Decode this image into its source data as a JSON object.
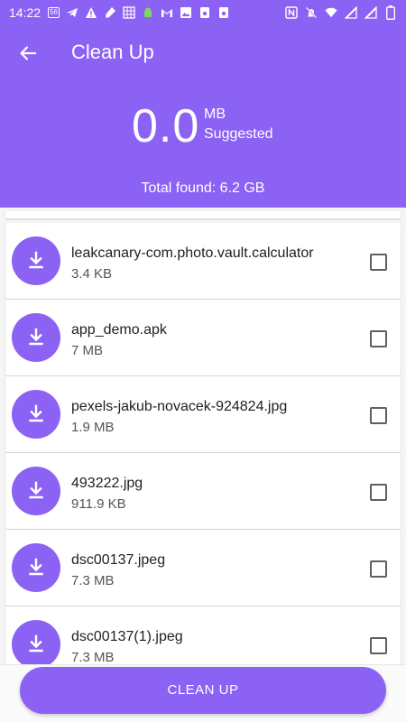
{
  "status_bar": {
    "time": "14:22",
    "left_icons": [
      "data-badge-icon",
      "telegram-icon",
      "warning-icon",
      "flashlight-icon",
      "grid-icon",
      "android-icon",
      "gmail-icon",
      "image-icon",
      "disk-icon",
      "disk-icon"
    ],
    "badge_text": "56",
    "right_icons": [
      "nfc-icon",
      "mute-icon",
      "wifi-icon",
      "signal-icon",
      "signal-icon",
      "battery-icon"
    ]
  },
  "header": {
    "title": "Clean Up",
    "size_value": "0.0",
    "size_unit": "MB",
    "size_label": "Suggested",
    "total_found": "Total found: 6.2 GB"
  },
  "files": [
    {
      "name": "leakcanary-com.photo.vault.calculator",
      "size": "3.4 KB",
      "checked": false
    },
    {
      "name": "app_demo.apk",
      "size": "7 MB",
      "checked": false
    },
    {
      "name": "pexels-jakub-novacek-924824.jpg",
      "size": "1.9 MB",
      "checked": false
    },
    {
      "name": "493222.jpg",
      "size": "911.9 KB",
      "checked": false
    },
    {
      "name": "dsc00137.jpeg",
      "size": "7.3 MB",
      "checked": false
    },
    {
      "name": "dsc00137(1).jpeg",
      "size": "7.3 MB",
      "checked": false
    }
  ],
  "actions": {
    "clean_up_label": "CLEAN UP"
  },
  "colors": {
    "accent": "#8c62f4",
    "background": "#f5f5f5"
  }
}
